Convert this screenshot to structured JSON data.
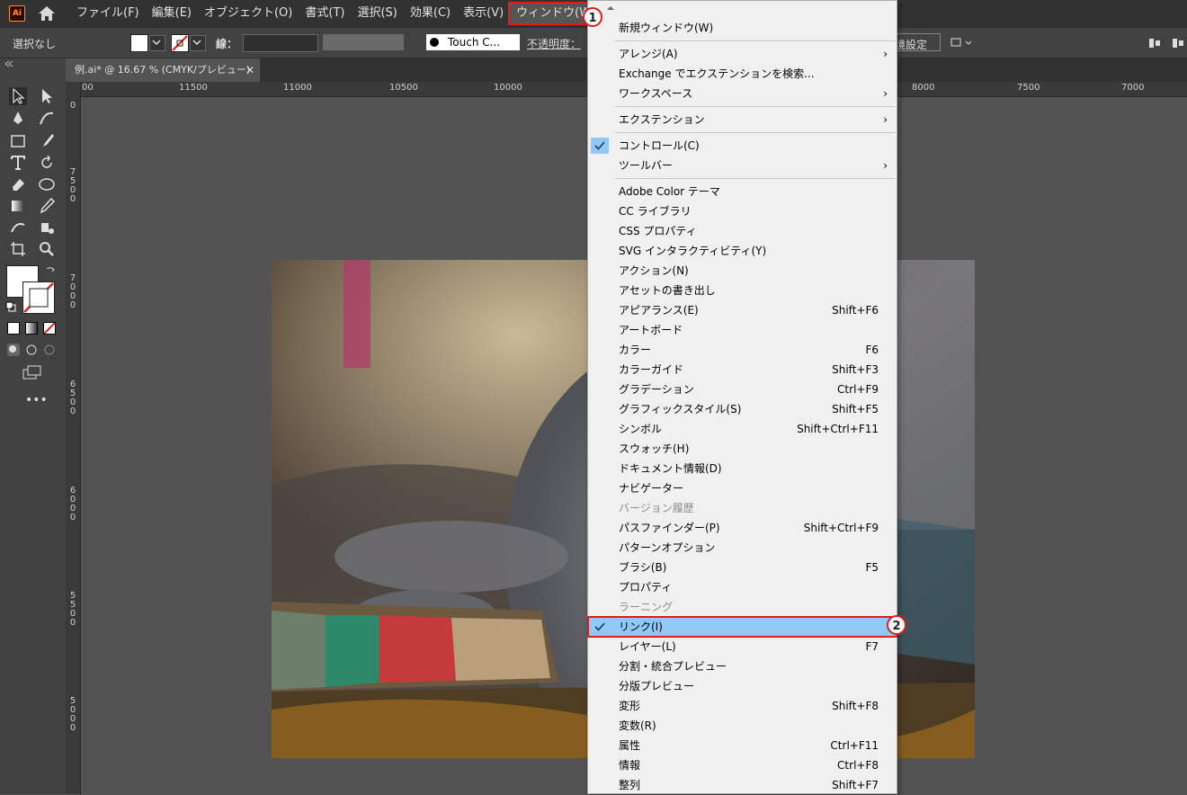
{
  "app": {
    "logo": "Ai"
  },
  "menubar": [
    "ファイル(F)",
    "編集(E)",
    "オブジェクト(O)",
    "書式(T)",
    "選択(S)",
    "効果(C)",
    "表示(V)",
    "ウィンドウ(W)"
  ],
  "control": {
    "selection": "選択なし",
    "stroke_label": "線：",
    "brush": "Touch C...",
    "opacity_label": "不透明度：",
    "right_label": "境設定"
  },
  "document": {
    "tab_title": "例.ai* @ 16.67 % (CMYK/プレビュー)"
  },
  "ruler": {
    "h_ticks": [
      "00",
      "11500",
      "11000",
      "10500",
      "10000",
      "8000",
      "7500",
      "7000"
    ],
    "v_ticks": [
      "0",
      "7500",
      "7000",
      "6500",
      "6000",
      "5500",
      "5000"
    ]
  },
  "window_menu": {
    "items": [
      {
        "label": "新規ウィンドウ(W)"
      },
      {
        "sep": true
      },
      {
        "label": "アレンジ(A)",
        "submenu": true
      },
      {
        "label": "Exchange でエクステンションを検索..."
      },
      {
        "label": "ワークスペース",
        "submenu": true
      },
      {
        "sep": true
      },
      {
        "label": "エクステンション",
        "submenu": true
      },
      {
        "sep": true
      },
      {
        "label": "コントロール(C)",
        "checked": true
      },
      {
        "label": "ツールバー",
        "submenu": true
      },
      {
        "sep": true
      },
      {
        "label": "Adobe Color テーマ"
      },
      {
        "label": "CC ライブラリ"
      },
      {
        "label": "CSS プロパティ"
      },
      {
        "label": "SVG インタラクティビティ(Y)"
      },
      {
        "label": "アクション(N)"
      },
      {
        "label": "アセットの書き出し"
      },
      {
        "label": "アピアランス(E)",
        "shortcut": "Shift+F6"
      },
      {
        "label": "アートボード"
      },
      {
        "label": "カラー",
        "shortcut": "F6"
      },
      {
        "label": "カラーガイド",
        "shortcut": "Shift+F3"
      },
      {
        "label": "グラデーション",
        "shortcut": "Ctrl+F9"
      },
      {
        "label": "グラフィックスタイル(S)",
        "shortcut": "Shift+F5"
      },
      {
        "label": "シンボル",
        "shortcut": "Shift+Ctrl+F11"
      },
      {
        "label": "スウォッチ(H)"
      },
      {
        "label": "ドキュメント情報(D)"
      },
      {
        "label": "ナビゲーター"
      },
      {
        "label": "バージョン履歴",
        "disabled": true
      },
      {
        "label": "パスファインダー(P)",
        "shortcut": "Shift+Ctrl+F9"
      },
      {
        "label": "パターンオプション"
      },
      {
        "label": "ブラシ(B)",
        "shortcut": "F5"
      },
      {
        "label": "プロパティ"
      },
      {
        "label": "ラーニング",
        "disabled": true
      },
      {
        "label": "リンク(I)",
        "checked": true,
        "highlight": true
      },
      {
        "label": "レイヤー(L)",
        "shortcut": "F7"
      },
      {
        "label": "分割・統合プレビュー"
      },
      {
        "label": "分版プレビュー"
      },
      {
        "label": "変形",
        "shortcut": "Shift+F8"
      },
      {
        "label": "変数(R)"
      },
      {
        "label": "属性",
        "shortcut": "Ctrl+F11"
      },
      {
        "label": "情報",
        "shortcut": "Ctrl+F8"
      },
      {
        "label": "整列",
        "shortcut": "Shift+F7"
      }
    ]
  },
  "callouts": [
    "1",
    "2"
  ],
  "colors": {
    "highlight": "#90c8f6",
    "callout_border": "#e21b1b",
    "ui_dark": "#323232"
  }
}
